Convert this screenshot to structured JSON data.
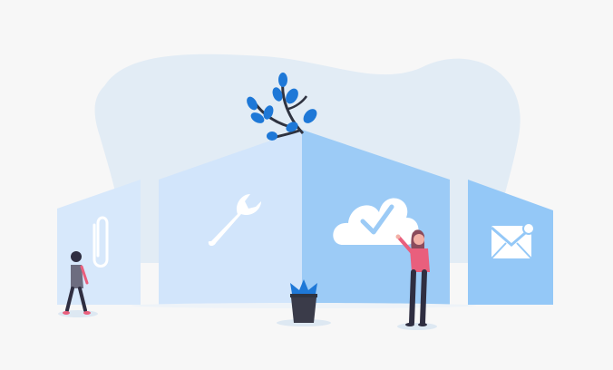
{
  "scene": {
    "colors": {
      "background": "#f7f7f7",
      "blob": "#e2ecf5",
      "panel_light": "#d7e8fb",
      "panel_mid": "#c4dcfa",
      "panel_accent": "#94c8f7",
      "icon_white": "#ffffff",
      "plant_blue": "#1e78d7",
      "stem_dark": "#2f3340",
      "figure_pink": "#e95f7d",
      "figure_dark": "#2f2e41",
      "hair": "#8b4b5c",
      "shadow": "#dde8f2"
    },
    "icons": [
      "paperclip-icon",
      "wrench-icon",
      "cloud-check-icon",
      "envelope-notification-icon"
    ],
    "figures": [
      "walking-person",
      "reaching-person"
    ],
    "decorations": [
      "background-blob",
      "branch-with-leaves",
      "potted-plant"
    ]
  }
}
